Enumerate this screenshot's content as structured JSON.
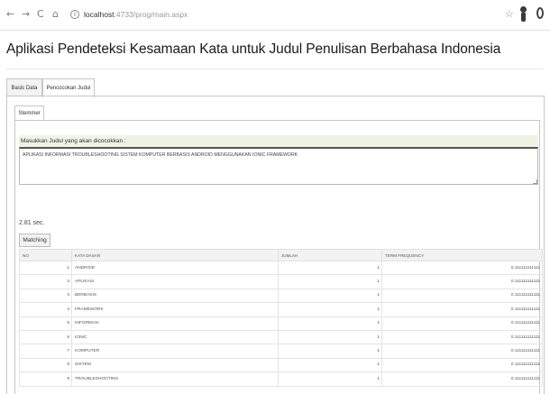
{
  "browser": {
    "url_host": "localhost",
    "url_path": ":4733/prog/main.aspx"
  },
  "page": {
    "title": "Aplikasi Pendeteksi Kesamaan Kata untuk Judul Penulisan Berbahasa Indonesia"
  },
  "tabs": [
    {
      "label": "Basis Data",
      "active": false
    },
    {
      "label": "Pencocokan Judul",
      "active": true
    }
  ],
  "inner_tab": {
    "label": "Stemmer"
  },
  "input": {
    "label": "Masukkan Judul yang akan dicocokkan :",
    "value": "APLIKASI INFORMASI TROUBLESHOOTING SISTEM KOMPUTER BERBASIS ANDROID MENGGUNAKAN IONIC FRAMEWORK"
  },
  "elapsed_time": "2.81 sec.",
  "match_button": "Matching",
  "table": {
    "headers": [
      "NO",
      "KATA DASAR",
      "JUMLAH",
      "TERM FREQUENCY"
    ],
    "rows": [
      {
        "no": "1",
        "kata": "ANDROID",
        "jumlah": "1",
        "tf": "0.111111111111"
      },
      {
        "no": "2",
        "kata": "APLIKASI",
        "jumlah": "1",
        "tf": "0.111111111111"
      },
      {
        "no": "3",
        "kata": "BERBASIS",
        "jumlah": "1",
        "tf": "0.111111111111"
      },
      {
        "no": "4",
        "kata": "FRAMEWORK",
        "jumlah": "1",
        "tf": "0.111111111111"
      },
      {
        "no": "5",
        "kata": "INFORMASI",
        "jumlah": "1",
        "tf": "0.111111111111"
      },
      {
        "no": "6",
        "kata": "IONIC",
        "jumlah": "1",
        "tf": "0.111111111111"
      },
      {
        "no": "7",
        "kata": "KOMPUTER",
        "jumlah": "1",
        "tf": "0.111111111111"
      },
      {
        "no": "8",
        "kata": "SISTEM",
        "jumlah": "1",
        "tf": "0.111111111111"
      },
      {
        "no": "9",
        "kata": "TROUBLESHOOTING",
        "jumlah": "1",
        "tf": "0.111111111111"
      }
    ]
  }
}
